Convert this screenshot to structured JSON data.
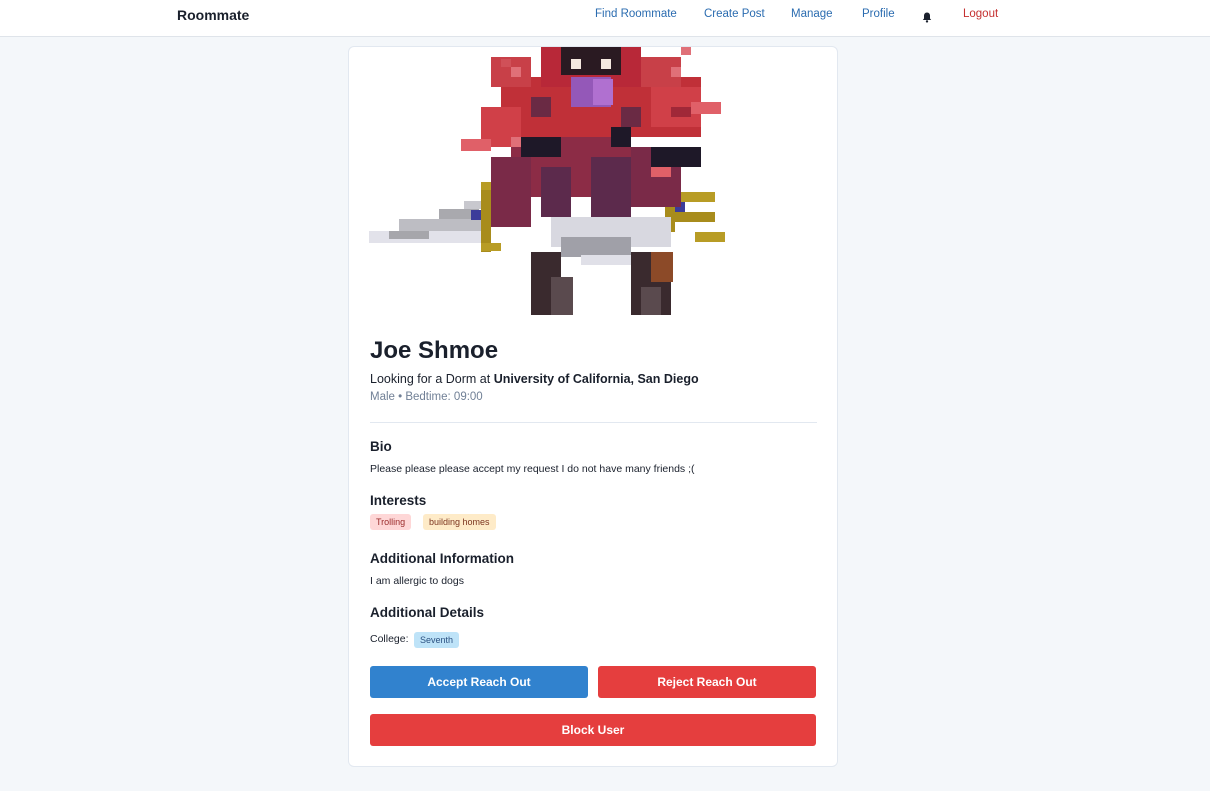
{
  "nav": {
    "brand": "Roommate",
    "links": [
      "Find Roommate",
      "Create Post",
      "Manage",
      "Profile"
    ],
    "bell_icon": "bell-icon",
    "logout": "Logout"
  },
  "profile": {
    "avatar_icon": "pixel-art-avatar",
    "name": "Joe Shmoe",
    "looking_prefix": "Looking for a Dorm at",
    "university": "University of California, San Diego",
    "meta": "Male • Bedtime: 09:00",
    "bio_title": "Bio",
    "bio": "Please please please accept my request I do not have many friends ;(",
    "interests_title": "Interests",
    "interests": [
      "Trolling",
      "building homes"
    ],
    "additional_info_title": "Additional Information",
    "additional_info": "I am allergic to dogs",
    "additional_details_title": "Additional Details",
    "college_label": "College:",
    "college": "Seventh"
  },
  "actions": {
    "accept": "Accept Reach Out",
    "reject": "Reject Reach Out",
    "block": "Block User"
  },
  "colors": {
    "accent_blue": "#3182ce",
    "danger_red": "#e53e3e",
    "link_blue": "#2b6cb0",
    "logout_red": "#c53030"
  }
}
